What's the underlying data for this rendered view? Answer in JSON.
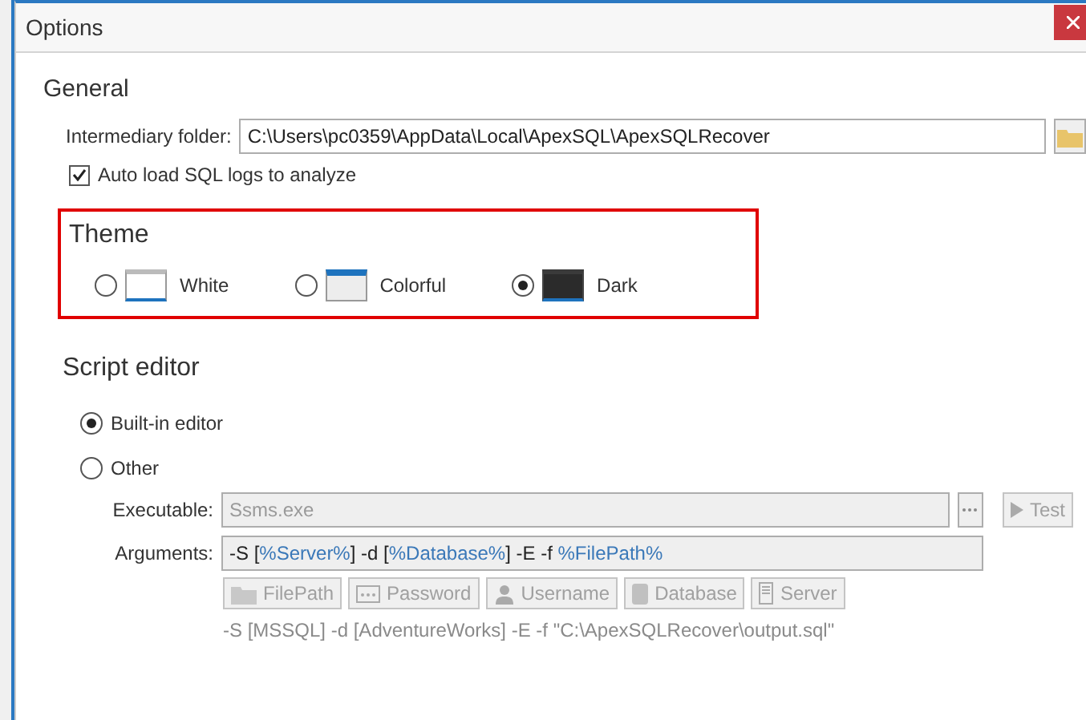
{
  "window": {
    "title": "Options"
  },
  "general": {
    "heading": "General",
    "intermediary_folder": {
      "label": "Intermediary folder:",
      "value": "C:\\Users\\pc0359\\AppData\\Local\\ApexSQL\\ApexSQLRecover"
    },
    "auto_load": {
      "label": "Auto load SQL logs to analyze",
      "checked": true
    }
  },
  "theme": {
    "heading": "Theme",
    "options": [
      {
        "label": "White",
        "kind": "white",
        "selected": false
      },
      {
        "label": "Colorful",
        "kind": "colorful",
        "selected": false
      },
      {
        "label": "Dark",
        "kind": "dark",
        "selected": true
      }
    ]
  },
  "script_editor": {
    "heading": "Script editor",
    "options": [
      {
        "label": "Built-in editor",
        "selected": true
      },
      {
        "label": "Other",
        "selected": false
      }
    ],
    "executable": {
      "label": "Executable:",
      "value": "Ssms.exe",
      "disabled": true
    },
    "test_button": {
      "label": "Test",
      "disabled": true
    },
    "arguments": {
      "label": "Arguments:",
      "segments": [
        {
          "text": "-S [",
          "kind": "plain"
        },
        {
          "text": "%Server%",
          "kind": "variable"
        },
        {
          "text": "] -d [",
          "kind": "plain"
        },
        {
          "text": "%Database%",
          "kind": "variable"
        },
        {
          "text": "] -E -f ",
          "kind": "plain"
        },
        {
          "text": "%FilePath%",
          "kind": "variable"
        }
      ]
    },
    "placeholder_buttons": [
      {
        "label": "FilePath",
        "kind": "folder",
        "disabled": true
      },
      {
        "label": "Password",
        "kind": "password",
        "disabled": true
      },
      {
        "label": "Username",
        "kind": "user",
        "disabled": true
      },
      {
        "label": "Database",
        "kind": "database",
        "disabled": true
      },
      {
        "label": "Server",
        "kind": "server",
        "disabled": true
      }
    ],
    "preview": "-S [MSSQL] -d [AdventureWorks] -E -f \"C:\\ApexSQLRecover\\output.sql\""
  }
}
